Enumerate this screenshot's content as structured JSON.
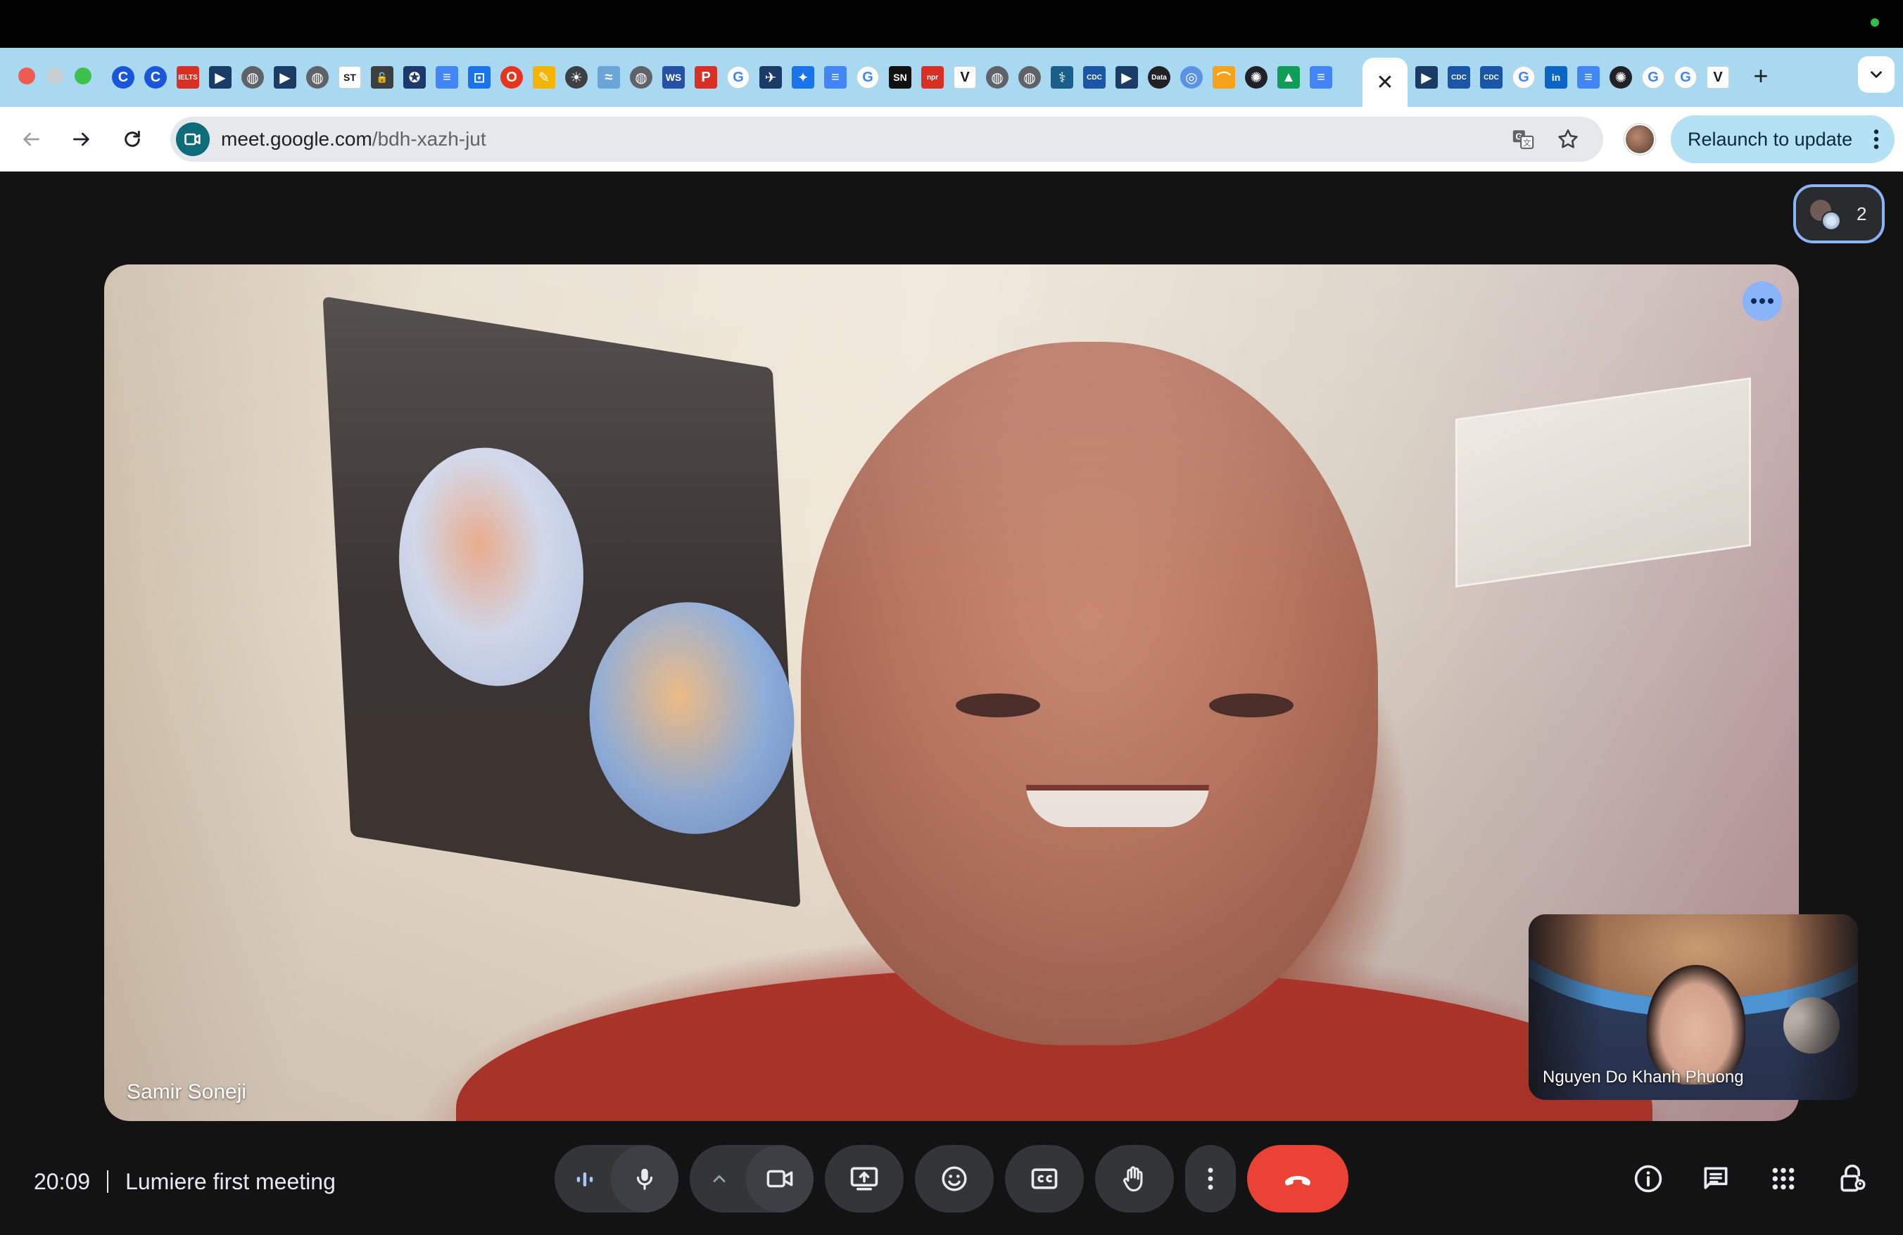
{
  "browser": {
    "tab_icons": [
      "chrome-c-icon",
      "chrome-c-icon",
      "ielts-icon",
      "arrow-doc-icon",
      "globe-icon",
      "arrow-doc-icon",
      "globe-icon",
      "st-icon",
      "lock-icon",
      "seal-icon",
      "docs-icon",
      "translate-icon",
      "opera-icon",
      "pen-icon",
      "bulb-icon",
      "map-icon",
      "globe-icon",
      "wos-icon",
      "p-icon",
      "google-icon",
      "plane-icon",
      "bird-icon",
      "docs-icon",
      "google-icon",
      "sn-icon",
      "npr-icon",
      "v-icon",
      "globe-icon",
      "globe-icon",
      "caduceus-icon",
      "cdc-icon",
      "arrow-doc-icon",
      "data-icon",
      "un-icon",
      "swoosh-icon",
      "openai-icon",
      "drive-icon",
      "docs-icon"
    ],
    "active_tab_close": "✕",
    "tab_icons_after": [
      "arrow-doc-icon",
      "cdc-icon",
      "cdc-icon",
      "google-icon",
      "linkedin-icon",
      "docs-icon",
      "openai-icon",
      "google-icon",
      "google-icon",
      "v-icon"
    ],
    "new_tab_label": "+",
    "url_host": "meet.google.com",
    "url_path": "/bdh-xazh-jut",
    "relaunch_label": "Relaunch to update"
  },
  "meet": {
    "participant_count": "2",
    "main_tile_name": "Samir Soneji",
    "self_view_name": "Nguyen Do Khanh Phuong",
    "time": "20:09",
    "meeting_title": "Lumiere first meeting"
  },
  "colors": {
    "accent_blue": "#8ab4f8",
    "end_call_red": "#ea4335",
    "tab_strip": "#a8d9f1",
    "meet_background": "#131314"
  }
}
